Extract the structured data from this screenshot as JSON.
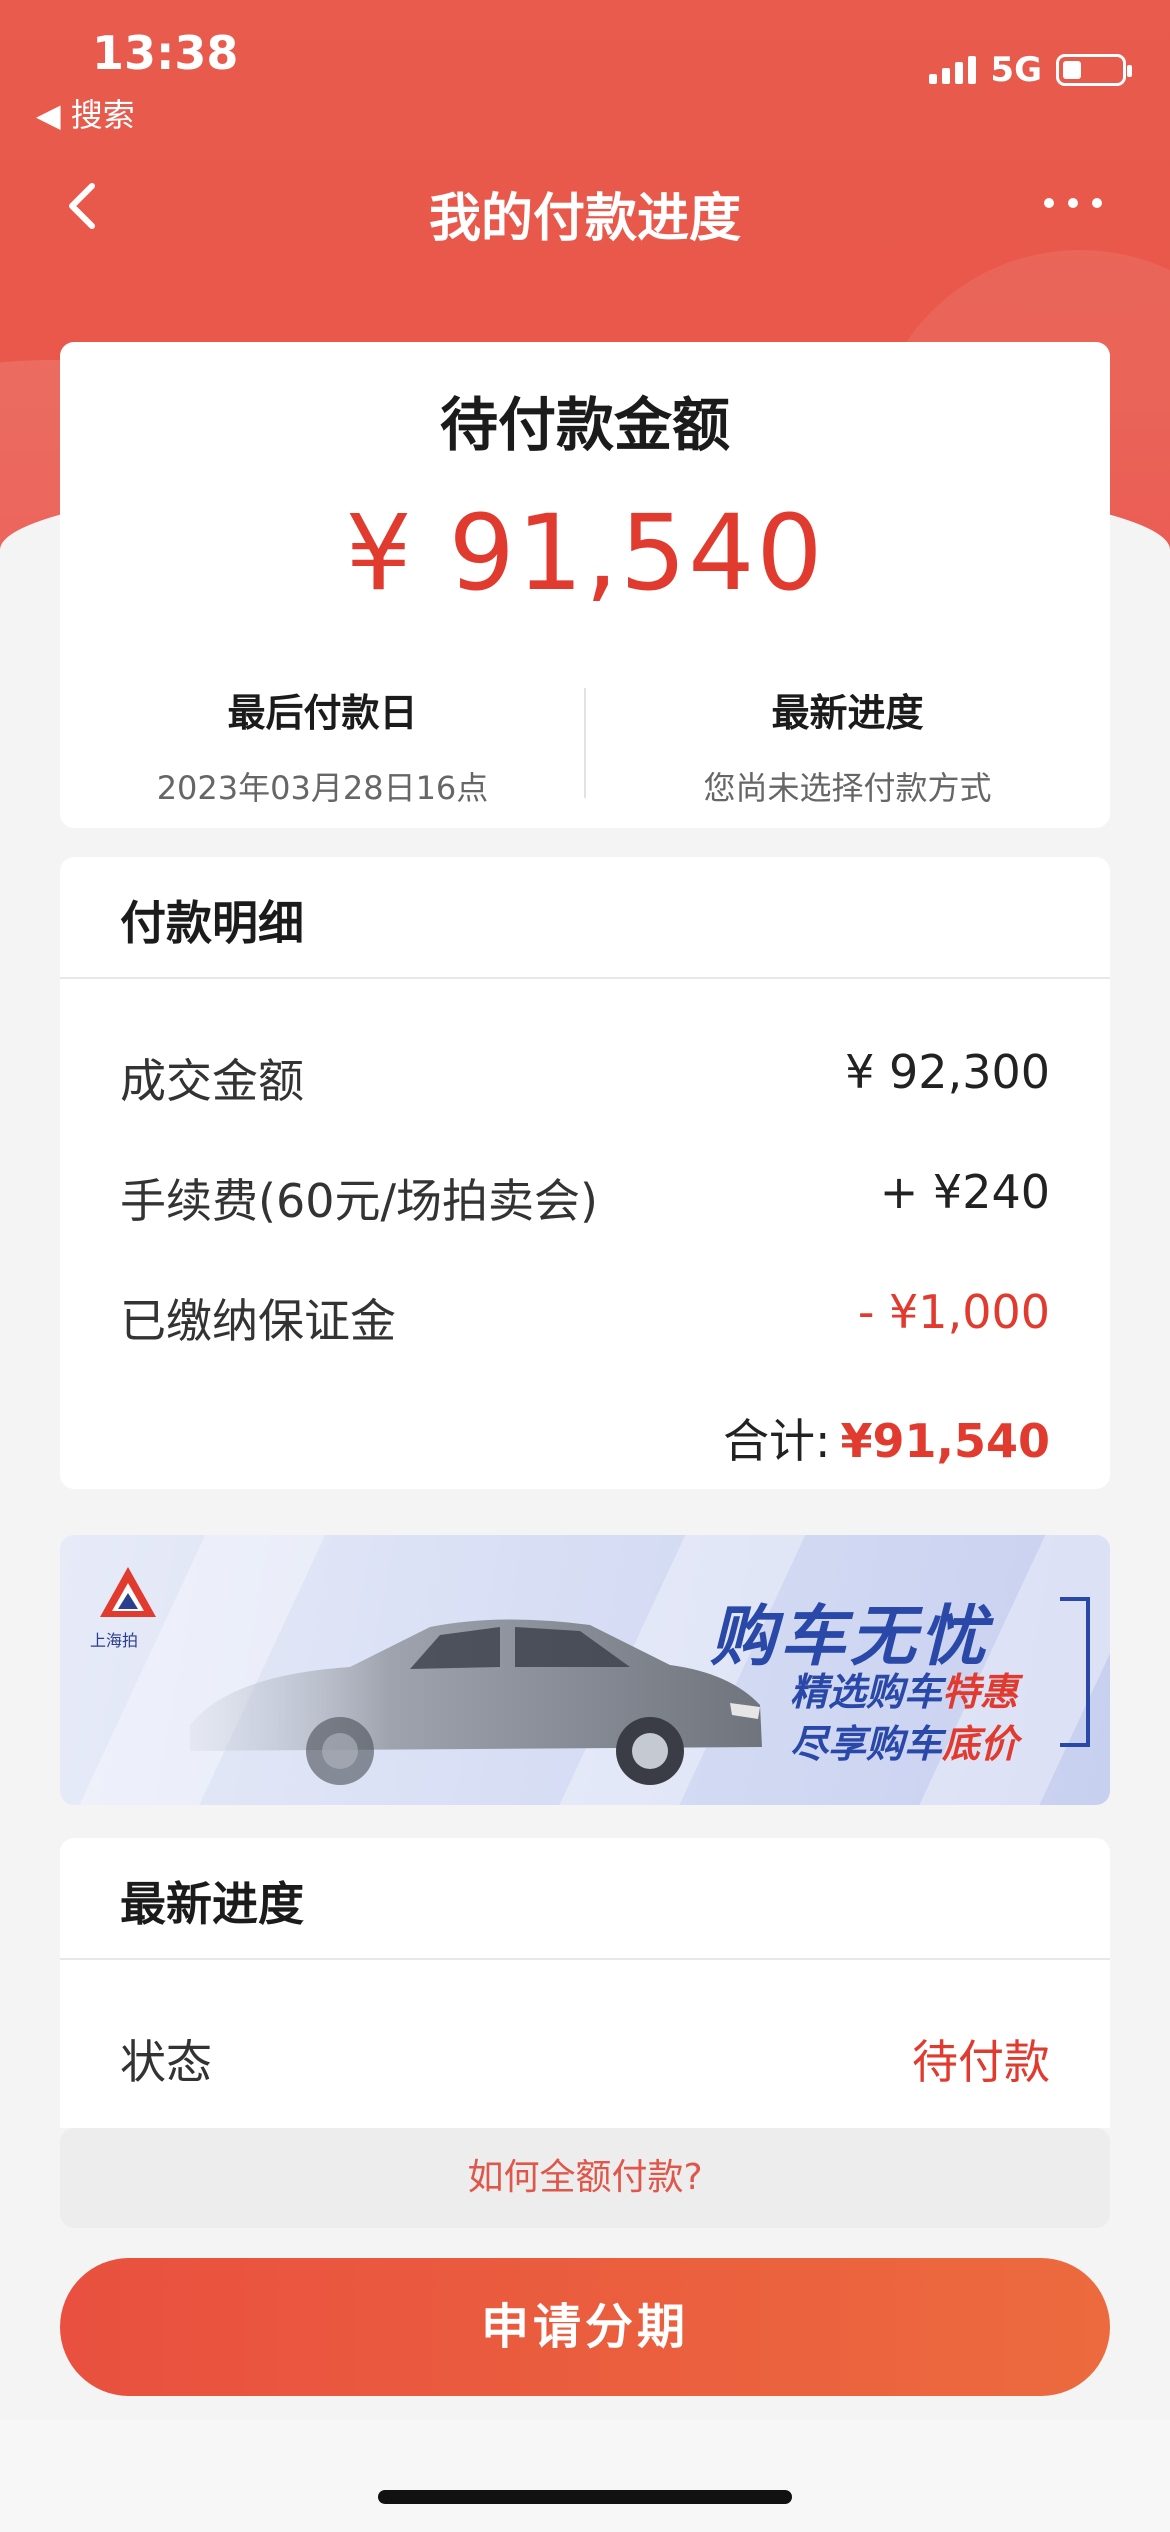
{
  "status_bar": {
    "time": "13:38",
    "back_app": "◀ 搜索",
    "network": "5G"
  },
  "nav": {
    "title": "我的付款进度"
  },
  "amount_card": {
    "title": "待付款金额",
    "amount": "¥ 91,540",
    "deadline_label": "最后付款日",
    "deadline_value": "2023年03月28日16点",
    "progress_label": "最新进度",
    "progress_value": "您尚未选择付款方式"
  },
  "payment_detail": {
    "title": "付款明细",
    "rows": [
      {
        "label": "成交金额",
        "value": "¥ 92,300"
      },
      {
        "label": "手续费(60元/场拍卖会)",
        "value": "+ ¥240"
      },
      {
        "label": "已缴纳保证金",
        "value": "- ¥1,000"
      }
    ],
    "total_label": "合计:",
    "total_value": "¥91,540"
  },
  "banner": {
    "logo_text": "上海拍",
    "title": "购车无忧",
    "line1_prefix": "精选购车",
    "line1_highlight": "特惠",
    "line2_prefix": "尽享购车",
    "line2_highlight": "底价"
  },
  "latest_progress": {
    "title": "最新进度",
    "status_label": "状态",
    "status_value": "待付款"
  },
  "actions": {
    "how_to_pay": "如何全额付款?",
    "apply_installment": "申请分期"
  },
  "colors": {
    "brand_red": "#e9574a",
    "accent_red": "#e13a2e",
    "banner_blue": "#2948a8"
  }
}
